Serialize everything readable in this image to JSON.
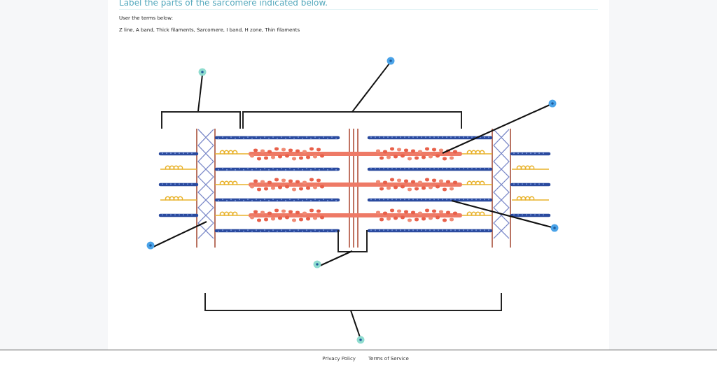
{
  "title": "Label the parts of the sarcomere indicated below.",
  "instructions": "User the terms below:",
  "terms": "Z line, A band, Thick filaments, Sarcomere, I band, H zone, Thin filaments",
  "markers": [
    {
      "color": "#8fdccf"
    },
    {
      "color": "#4aa3e8"
    },
    {
      "color": "#4aa3e8"
    },
    {
      "color": "#4aa3e8"
    },
    {
      "color": "#8fdccf"
    },
    {
      "color": "#8fdccf"
    },
    {
      "color": "#4aa3e8"
    }
  ],
  "footer_links": [
    "Privacy Policy",
    "Terms of Service"
  ]
}
